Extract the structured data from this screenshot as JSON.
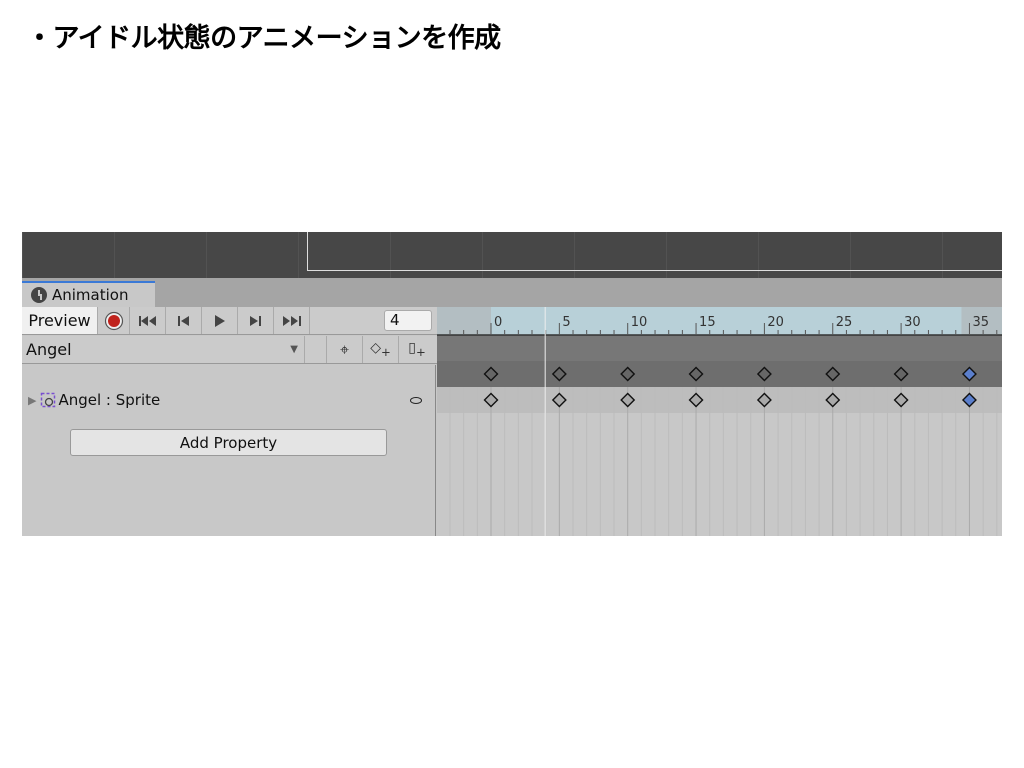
{
  "slide_title": "・アイドル状態のアニメーションを作成",
  "window": {
    "tab_label": "Animation",
    "tab_icon": "clock-icon"
  },
  "toolbar": {
    "preview_label": "Preview",
    "record_color": "#c0231d",
    "frame_value": "4"
  },
  "clip": {
    "selected": "Angel"
  },
  "properties": [
    {
      "label": "Angel : Sprite"
    }
  ],
  "add_property_label": "Add Property",
  "timeline": {
    "tick_labels": [
      "0",
      "5",
      "10",
      "15",
      "20",
      "25",
      "30",
      "35"
    ],
    "current_frame": 4,
    "keyframes": [
      0,
      5,
      10,
      15,
      20,
      25,
      30,
      35
    ],
    "selected_keyframe": 35,
    "selected_color": "#5b7fcc"
  }
}
